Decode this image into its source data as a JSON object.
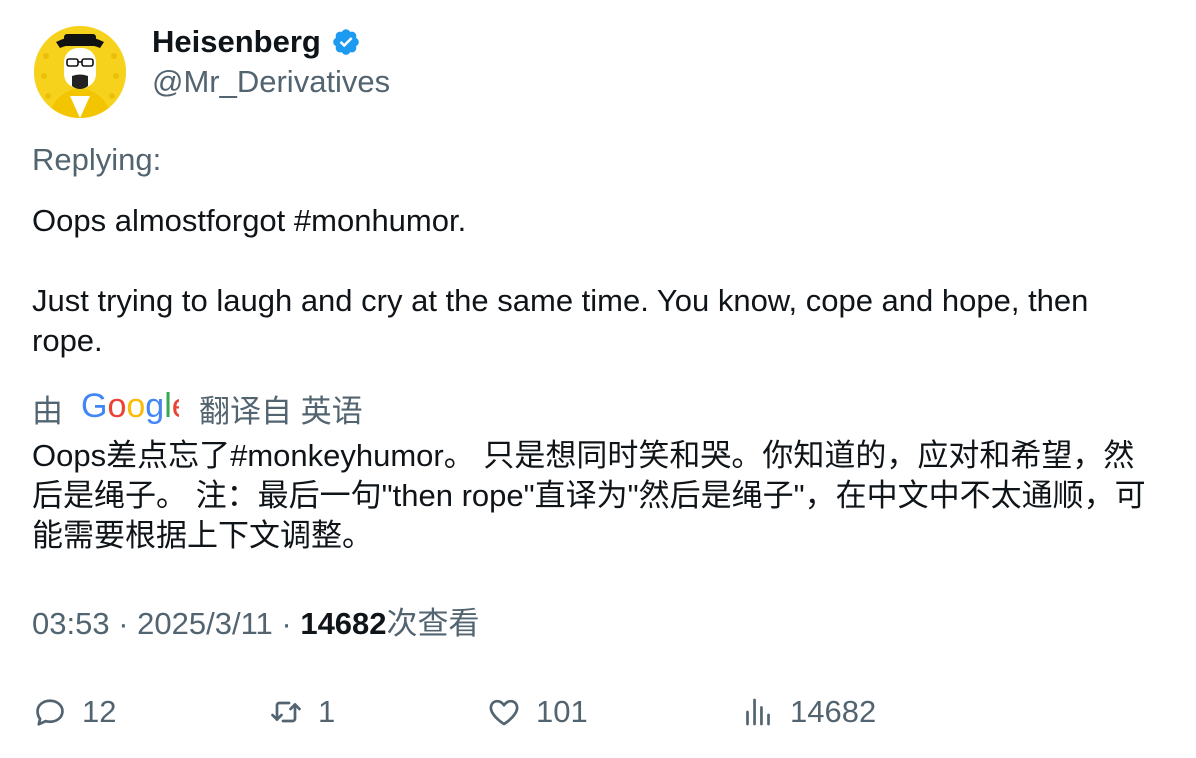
{
  "author": {
    "name": "Heisenberg",
    "handle": "@Mr_Derivatives",
    "verified": true,
    "accent_color": "#1d9bf0",
    "avatar_bg": "#f6d21c"
  },
  "replying_label": "Replying:",
  "tweet": {
    "line1": "Oops almostforgot #monhumor.",
    "line2": "Just trying to laugh and cry at the same time. You know, cope and hope, then rope."
  },
  "translation": {
    "by": "由",
    "provider_logo": "Google",
    "from_label": "翻译自 英语",
    "text": "Oops差点忘了#monkeyhumor。 只是想同时笑和哭。你知道的，应对和希望，然后是绳子。 注：最后一句\"then rope\"直译为\"然后是绳子\"，在中文中不太通顺，可能需要根据上下文调整。"
  },
  "meta": {
    "time": "03:53",
    "sep1": " · ",
    "date": "2025/3/11",
    "sep2": " · ",
    "views": "14682",
    "views_label": "次查看"
  },
  "actions": {
    "replies": "12",
    "retweets": "1",
    "likes": "101",
    "views": "14682"
  }
}
